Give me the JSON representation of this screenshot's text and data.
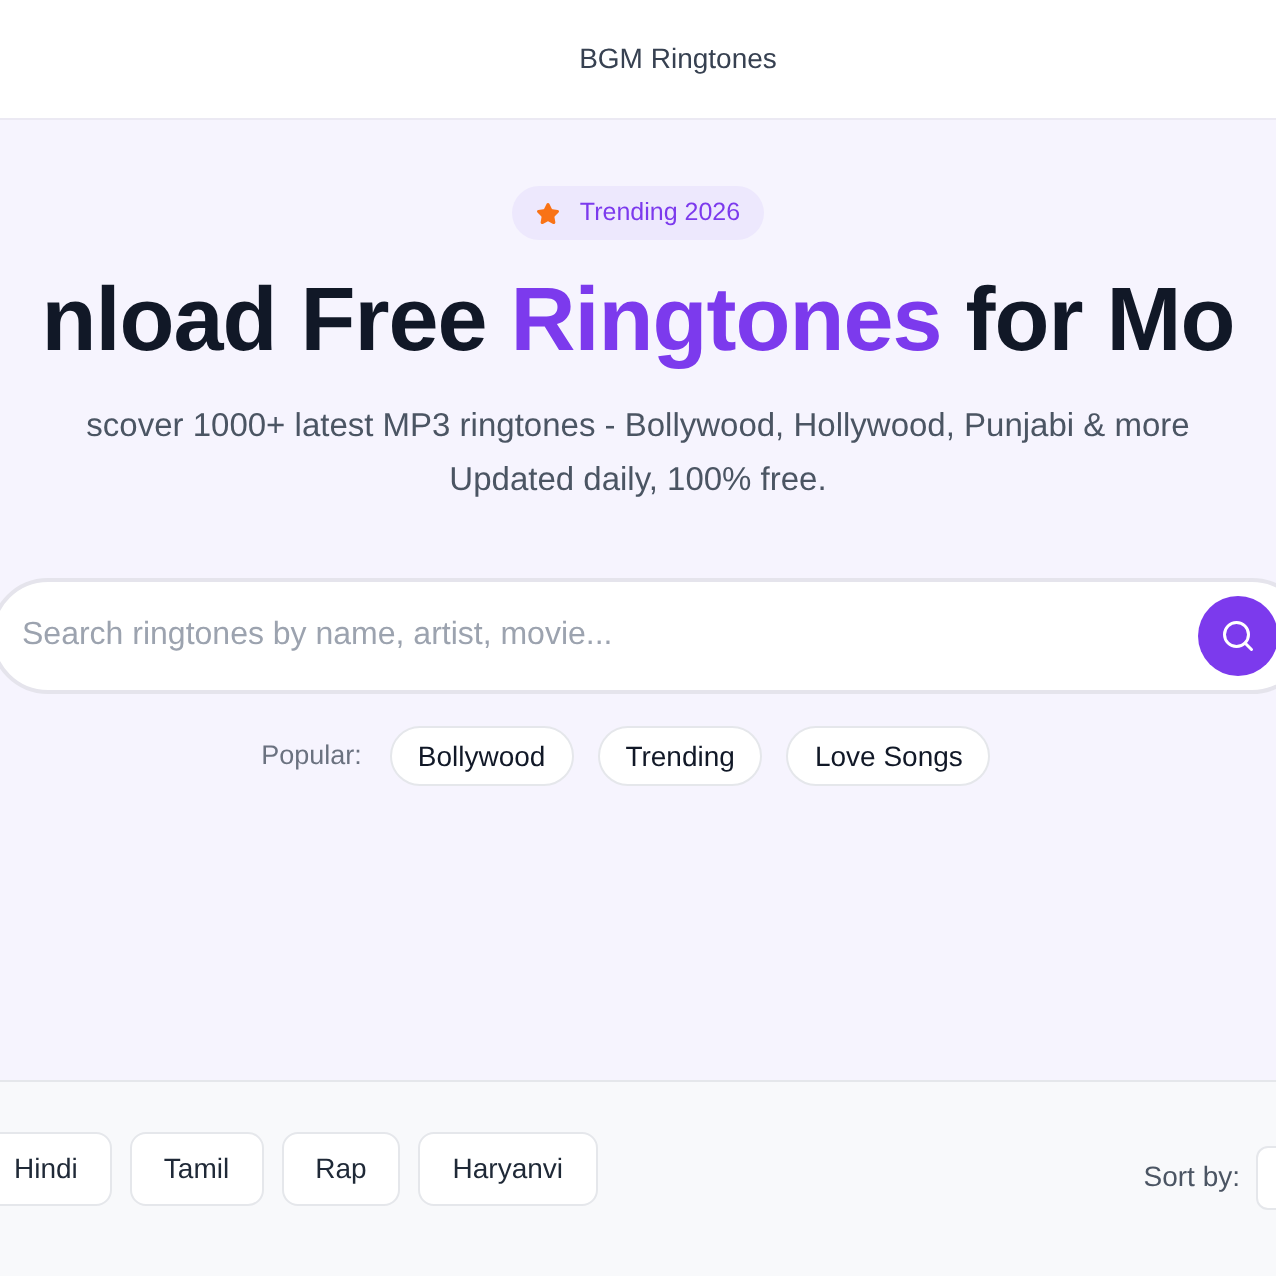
{
  "header": {
    "title": "BGM Ringtones"
  },
  "hero": {
    "badge": "Trending 2026",
    "heading_before": "nload Free ",
    "heading_highlight": "Ringtones",
    "heading_after": " for Mo",
    "subtitle_lines": [
      "scover 1000+ latest MP3 ringtones - Bollywood, Hollywood, Punjabi & more",
      "Updated daily, 100% free."
    ]
  },
  "search": {
    "placeholder": "Search ringtones by name, artist, movie..."
  },
  "popular": {
    "label": "Popular:",
    "tags": [
      "Bollywood",
      "Trending",
      "Love Songs"
    ]
  },
  "filters": {
    "categories": [
      "Hindi",
      "Tamil",
      "Rap",
      "Haryanvi"
    ],
    "sort_label": "Sort by:"
  }
}
